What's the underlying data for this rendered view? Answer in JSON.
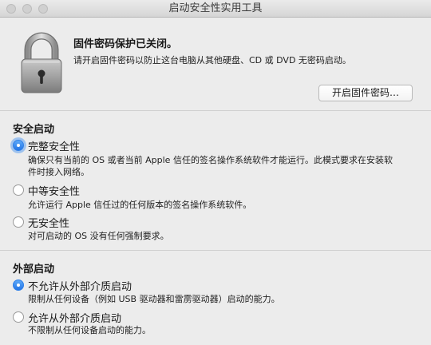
{
  "window": {
    "title": "启动安全性实用工具"
  },
  "firmware": {
    "heading": "固件密码保护已关闭。",
    "description": "请开启固件密码以防止这台电脑从其他硬盘、CD 或 DVD 无密码启动。",
    "button_label": "开启固件密码…"
  },
  "secure_boot": {
    "title": "安全启动",
    "options": [
      {
        "label": "完整安全性",
        "description": "确保只有当前的 OS 或者当前 Apple 信任的签名操作系统软件才能运行。此模式要求在安装软件时接入网络。",
        "selected": true
      },
      {
        "label": "中等安全性",
        "description": "允许运行 Apple 信任过的任何版本的签名操作系统软件。",
        "selected": false
      },
      {
        "label": "无安全性",
        "description": "对可启动的 OS 没有任何强制要求。",
        "selected": false
      }
    ]
  },
  "external_boot": {
    "title": "外部启动",
    "options": [
      {
        "label": "不允许从外部介质启动",
        "description": "限制从任何设备（例如 USB 驱动器和雷雳驱动器）启动的能力。",
        "selected": true
      },
      {
        "label": "允许从外部介质启动",
        "description": "不限制从任何设备启动的能力。",
        "selected": false
      }
    ]
  },
  "colors": {
    "accent": "#2c7ee8",
    "window_background": "#ececec"
  },
  "icons": {
    "lock": "padlock-icon"
  }
}
